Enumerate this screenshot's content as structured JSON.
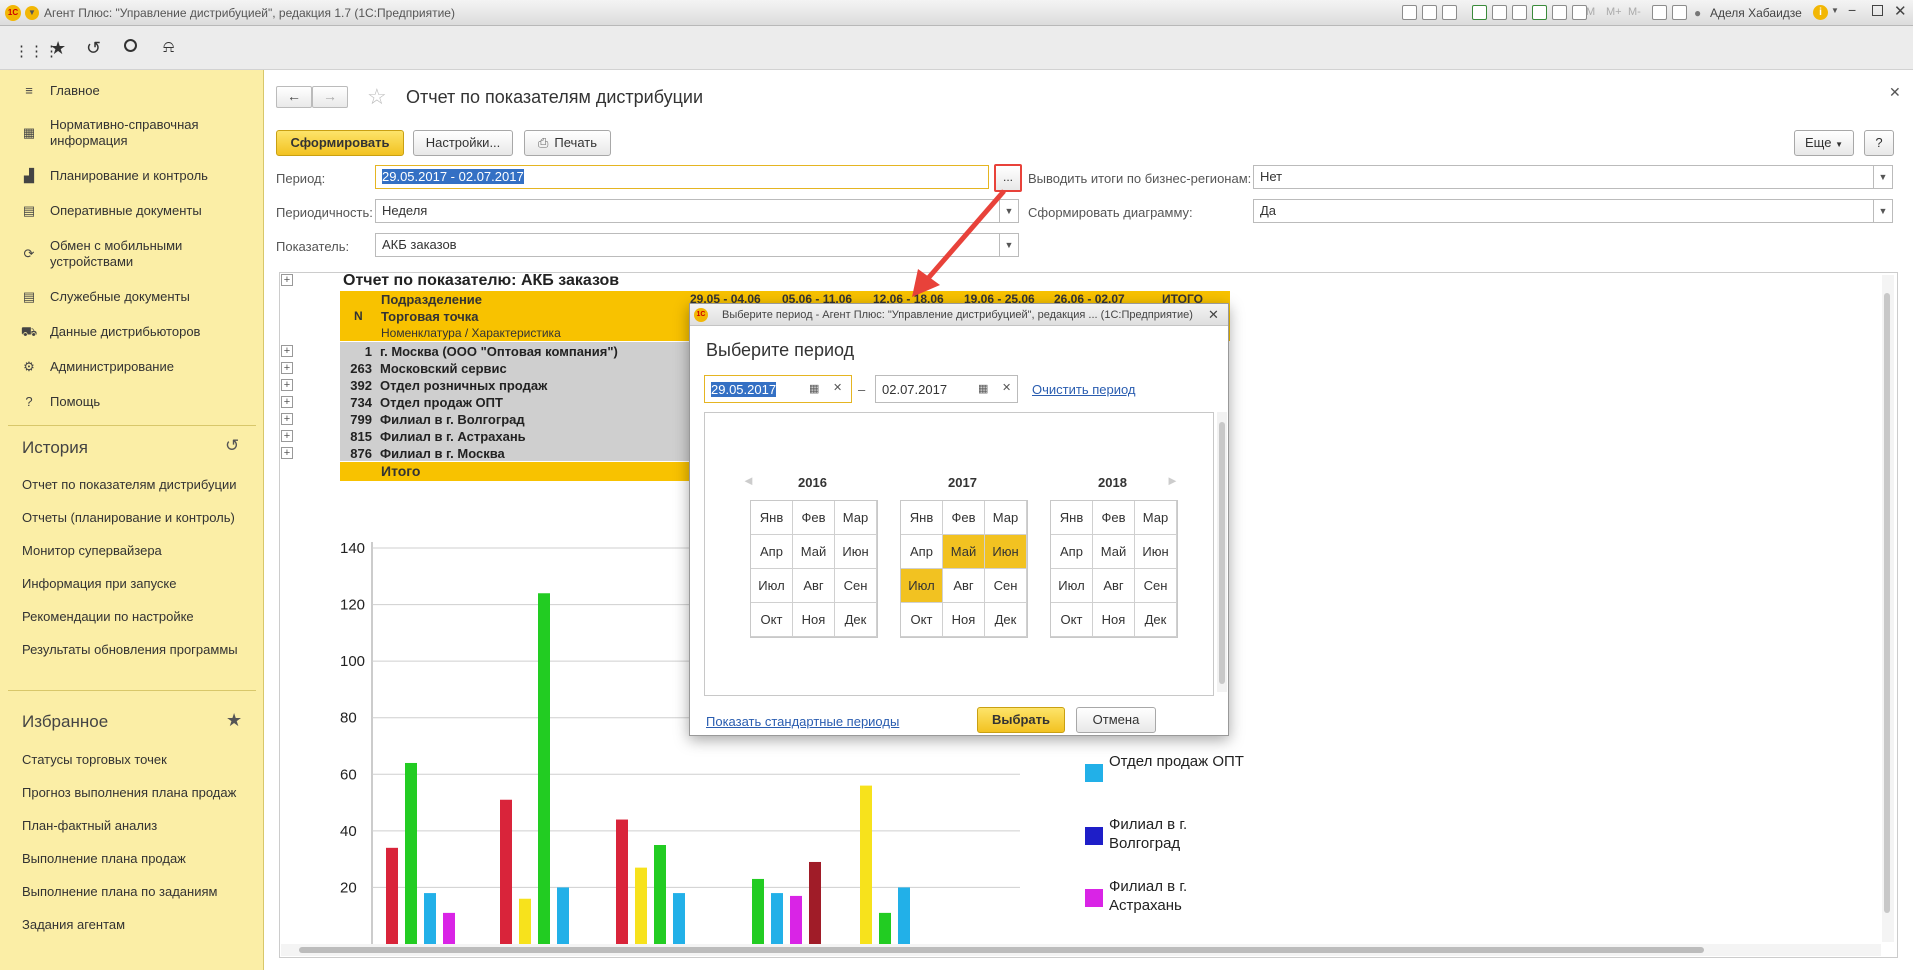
{
  "window": {
    "title": "Агент Плюс: \"Управление дистрибуцией\", редакция 1.7  (1С:Предприятие)",
    "user": "Аделя Хабаидзе",
    "toolbar_labels": [
      "M",
      "M+",
      "M-"
    ]
  },
  "sidebar": {
    "items": [
      {
        "label": "Главное",
        "icon": "menu-lines-icon"
      },
      {
        "label": "Нормативно-справочная информация",
        "icon": "grid-table-icon"
      },
      {
        "label": "Планирование и контроль",
        "icon": "bar-chart-icon"
      },
      {
        "label": "Оперативные документы",
        "icon": "documents-icon"
      },
      {
        "label": "Обмен с мобильными устройствами",
        "icon": "sync-icon"
      },
      {
        "label": "Служебные документы",
        "icon": "documents-icon"
      },
      {
        "label": "Данные дистрибьюторов",
        "icon": "cart-icon"
      },
      {
        "label": "Администрирование",
        "icon": "gear-icon"
      },
      {
        "label": "Помощь",
        "icon": "question-icon"
      }
    ],
    "history_title": "История",
    "history": [
      "Отчет по показателям дистрибуции",
      "Отчеты (планирование и контроль)",
      "Монитор супервайзера",
      "Информация при запуске",
      "Рекомендации по настройке",
      "Результаты обновления программы"
    ],
    "favorites_title": "Избранное",
    "favorites": [
      "Статусы торговых точек",
      "Прогноз выполнения плана продаж",
      "План-фактный анализ",
      "Выполнение плана продаж",
      "Выполнение плана по заданиям",
      "Задания агентам"
    ]
  },
  "form": {
    "title": "Отчет по показателям дистрибуции",
    "generate_button": "Сформировать",
    "settings_button": "Настройки...",
    "print_button": "Печать",
    "more_button": "Еще",
    "help_button": "?",
    "period_label": "Период:",
    "period_value": "29.05.2017 - 02.07.2017",
    "period_picker": "...",
    "periodicity_label": "Периодичность:",
    "periodicity_value": "Неделя",
    "indicator_label": "Показатель:",
    "indicator_value": "АКБ заказов",
    "regions_label": "Выводить итоги по бизнес-регионам:",
    "regions_value": "Нет",
    "chart_label": "Сформировать диаграмму:",
    "chart_value": "Да"
  },
  "report": {
    "title": "Отчет по показателю: АКБ заказов",
    "header_rows": [
      "Подразделение",
      "Торговая точка",
      "Номенклатура / Характеристика"
    ],
    "n_label": "N",
    "columns": [
      "29.05 - 04.06",
      "05.06 - 11.06",
      "12.06 - 18.06",
      "19.06 - 25.06",
      "26.06 - 02.07",
      "ИТОГО"
    ],
    "rows": [
      {
        "n": "1",
        "name": "г. Москва  (ООО \"Оптовая компания\")"
      },
      {
        "n": "263",
        "name": "Московский сервис"
      },
      {
        "n": "392",
        "name": "Отдел розничных продаж"
      },
      {
        "n": "734",
        "name": "Отдел продаж ОПТ"
      },
      {
        "n": "799",
        "name": "Филиал в г. Волгоград"
      },
      {
        "n": "815",
        "name": "Филиал в г. Астрахань"
      },
      {
        "n": "876",
        "name": "Филиал в г. Москва"
      }
    ],
    "total_label": "Итого"
  },
  "chart_data": {
    "type": "bar",
    "ylim": [
      0,
      140
    ],
    "yticks": [
      20,
      40,
      60,
      80,
      100,
      120,
      140
    ],
    "legend": [
      {
        "label": "Отдел продаж ОПТ",
        "color": "#22b0e8"
      },
      {
        "label": "Филиал в г. Волгоград",
        "color": "#1e1ec8"
      },
      {
        "label": "Филиал в г. Астрахань",
        "color": "#d924e6"
      }
    ],
    "bars": [
      {
        "group": 0,
        "color": "#d9243a",
        "value": 34
      },
      {
        "group": 0,
        "color": "#22cc22",
        "value": 64
      },
      {
        "group": 0,
        "color": "#22b0e8",
        "value": 18
      },
      {
        "group": 0,
        "color": "#d924e6",
        "value": 11
      },
      {
        "group": 1,
        "color": "#d9243a",
        "value": 51
      },
      {
        "group": 1,
        "color": "#f7e21c",
        "value": 16
      },
      {
        "group": 1,
        "color": "#22cc22",
        "value": 124
      },
      {
        "group": 1,
        "color": "#22b0e8",
        "value": 20
      },
      {
        "group": 2,
        "color": "#d9243a",
        "value": 44
      },
      {
        "group": 2,
        "color": "#f7e21c",
        "value": 27
      },
      {
        "group": 2,
        "color": "#22cc22",
        "value": 35
      },
      {
        "group": 2,
        "color": "#22b0e8",
        "value": 18
      },
      {
        "group": 3,
        "color": "#22cc22",
        "value": 23
      },
      {
        "group": 3,
        "color": "#22b0e8",
        "value": 18
      },
      {
        "group": 3,
        "color": "#d924e6",
        "value": 17
      },
      {
        "group": 3,
        "color": "#a01c28",
        "value": 29
      },
      {
        "group": 4,
        "color": "#f7e21c",
        "value": 56
      },
      {
        "group": 4,
        "color": "#22cc22",
        "value": 11
      },
      {
        "group": 4,
        "color": "#22b0e8",
        "value": 20
      }
    ]
  },
  "dialog": {
    "title": "Выберите период - Агент Плюс: \"Управление дистрибуцией\", редакция ...  (1С:Предприятие)",
    "heading": "Выберите период",
    "date_from": "29.05.2017",
    "date_to": "02.07.2017",
    "dash": "–",
    "clear_link": "Очистить период",
    "years": [
      "2016",
      "2017",
      "2018"
    ],
    "months": [
      "Янв",
      "Фев",
      "Мар",
      "Апр",
      "Май",
      "Июн",
      "Июл",
      "Авг",
      "Сен",
      "Окт",
      "Ноя",
      "Дек"
    ],
    "selected_months_2017": [
      "Май",
      "Июн",
      "Июл"
    ],
    "standard_link": "Показать стандартные периоды",
    "select_button": "Выбрать",
    "cancel_button": "Отмена"
  },
  "colors": {
    "accent": "#f2c221",
    "sidebar": "#fbeea6",
    "highlight": "#e8423a"
  }
}
